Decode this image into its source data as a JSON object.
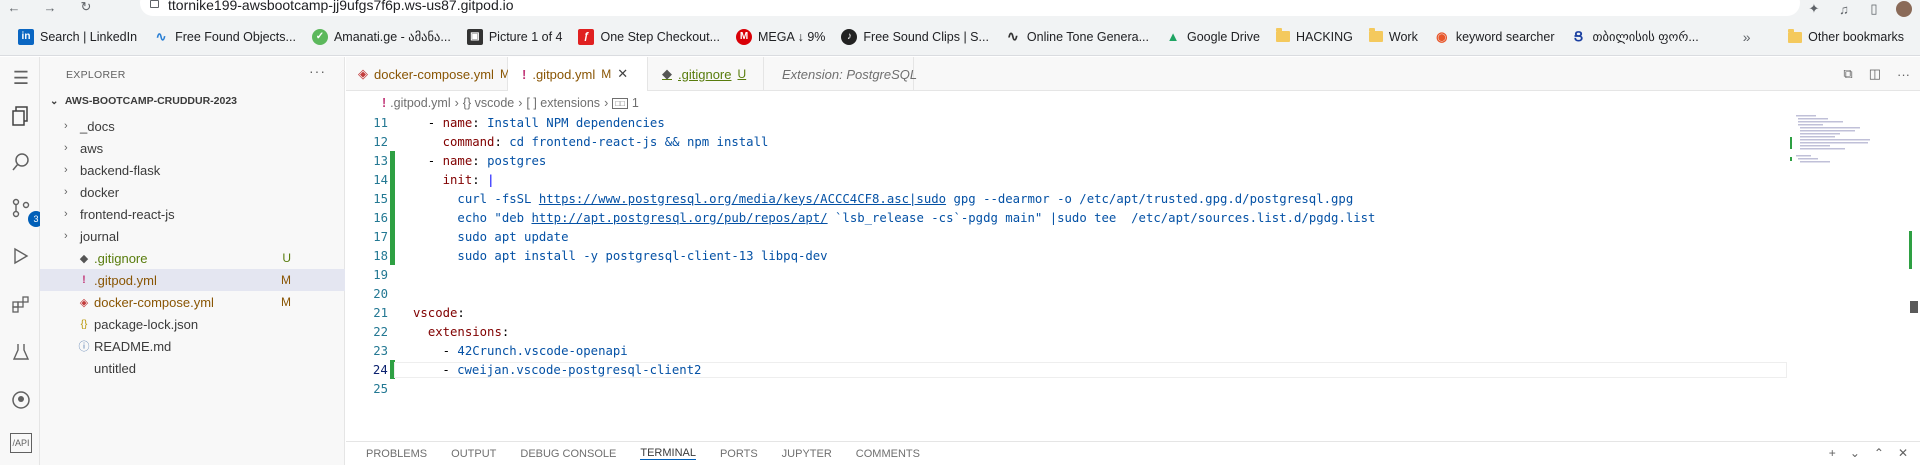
{
  "browser": {
    "url": "ttornike199-awsbootcamp-jj9ufgs7f6p.ws-us87.gitpod.io",
    "bookmarks": [
      {
        "label": "Search | LinkedIn",
        "icon": "linkedin-icon"
      },
      {
        "label": "Free Found Objects...",
        "icon": "sound-wave-icon"
      },
      {
        "label": "Amanati.ge - ამანა...",
        "icon": "shield-check-icon"
      },
      {
        "label": "Picture 1 of 4",
        "icon": "clipboard-icon"
      },
      {
        "label": "One Step Checkout...",
        "icon": "pdf-icon"
      },
      {
        "label": "MEGA ↓ 9%",
        "icon": "mega-icon"
      },
      {
        "label": "Free Sound Clips | S...",
        "icon": "soundclip-icon"
      },
      {
        "label": "Online Tone Genera...",
        "icon": "tone-wave-icon"
      },
      {
        "label": "Google Drive",
        "icon": "google-drive-icon"
      },
      {
        "label": "HACKING",
        "icon": "folder-icon"
      },
      {
        "label": "Work",
        "icon": "folder-icon"
      },
      {
        "label": "keyword searcher",
        "icon": "keyword-icon"
      },
      {
        "label": "თბილისის ფორ...",
        "icon": "g-logo-icon"
      }
    ],
    "other_bookmarks": "Other bookmarks"
  },
  "explorer": {
    "title": "EXPLORER",
    "root": "AWS-BOOTCAMP-CRUDDUR-2023",
    "items": [
      {
        "label": "_docs",
        "type": "folder"
      },
      {
        "label": "aws",
        "type": "folder"
      },
      {
        "label": "backend-flask",
        "type": "folder"
      },
      {
        "label": "docker",
        "type": "folder"
      },
      {
        "label": "frontend-react-js",
        "type": "folder"
      },
      {
        "label": "journal",
        "type": "folder"
      },
      {
        "label": ".gitignore",
        "type": "file",
        "status": "U"
      },
      {
        "label": ".gitpod.yml",
        "type": "file",
        "status": "M"
      },
      {
        "label": "docker-compose.yml",
        "type": "file",
        "status": "M"
      },
      {
        "label": "package-lock.json",
        "type": "file",
        "status": ""
      },
      {
        "label": "README.md",
        "type": "file",
        "status": ""
      },
      {
        "label": "untitled",
        "type": "file",
        "status": ""
      }
    ],
    "scm_badge": "3"
  },
  "tabs": [
    {
      "label": "docker-compose.yml",
      "status": "M"
    },
    {
      "label": ".gitpod.yml",
      "status": "M"
    },
    {
      "label": ".gitignore",
      "status": "U"
    },
    {
      "label": "Extension: PostgreSQL",
      "status": ""
    }
  ],
  "breadcrumb": [
    ".gitpod.yml",
    "{} vscode",
    "[ ] extensions",
    "1"
  ],
  "code": [
    {
      "n": "11",
      "text": "  - name: Install NPM dependencies"
    },
    {
      "n": "12",
      "text": "    command: cd frontend-react-js && npm install"
    },
    {
      "n": "13",
      "text": "  - name: postgres"
    },
    {
      "n": "14",
      "text": "    init: |"
    },
    {
      "n": "15",
      "text": "      curl -fsSL https://www.postgresql.org/media/keys/ACCC4CF8.asc|sudo gpg --dearmor -o /etc/apt/trusted.gpg.d/postgresql.gpg"
    },
    {
      "n": "16",
      "text": "      echo \"deb http://apt.postgresql.org/pub/repos/apt/ `lsb_release -cs`-pgdg main\" |sudo tee  /etc/apt/sources.list.d/pgdg.list"
    },
    {
      "n": "17",
      "text": "      sudo apt update"
    },
    {
      "n": "18",
      "text": "      sudo apt install -y postgresql-client-13 libpq-dev"
    },
    {
      "n": "19",
      "text": ""
    },
    {
      "n": "20",
      "text": ""
    },
    {
      "n": "21",
      "text": "vscode:"
    },
    {
      "n": "22",
      "text": "  extensions:"
    },
    {
      "n": "23",
      "text": "    - 42Crunch.vscode-openapi"
    },
    {
      "n": "24",
      "text": "    - cweijan.vscode-postgresql-client2"
    },
    {
      "n": "25",
      "text": ""
    }
  ],
  "panel_tabs": [
    "PROBLEMS",
    "OUTPUT",
    "DEBUG CONSOLE",
    "TERMINAL",
    "PORTS",
    "JUPYTER",
    "COMMENTS"
  ],
  "colors": {
    "accent": "#005fb8",
    "modified": "#895503",
    "untracked": "#587c0c",
    "gutter_added": "#2ea043"
  }
}
